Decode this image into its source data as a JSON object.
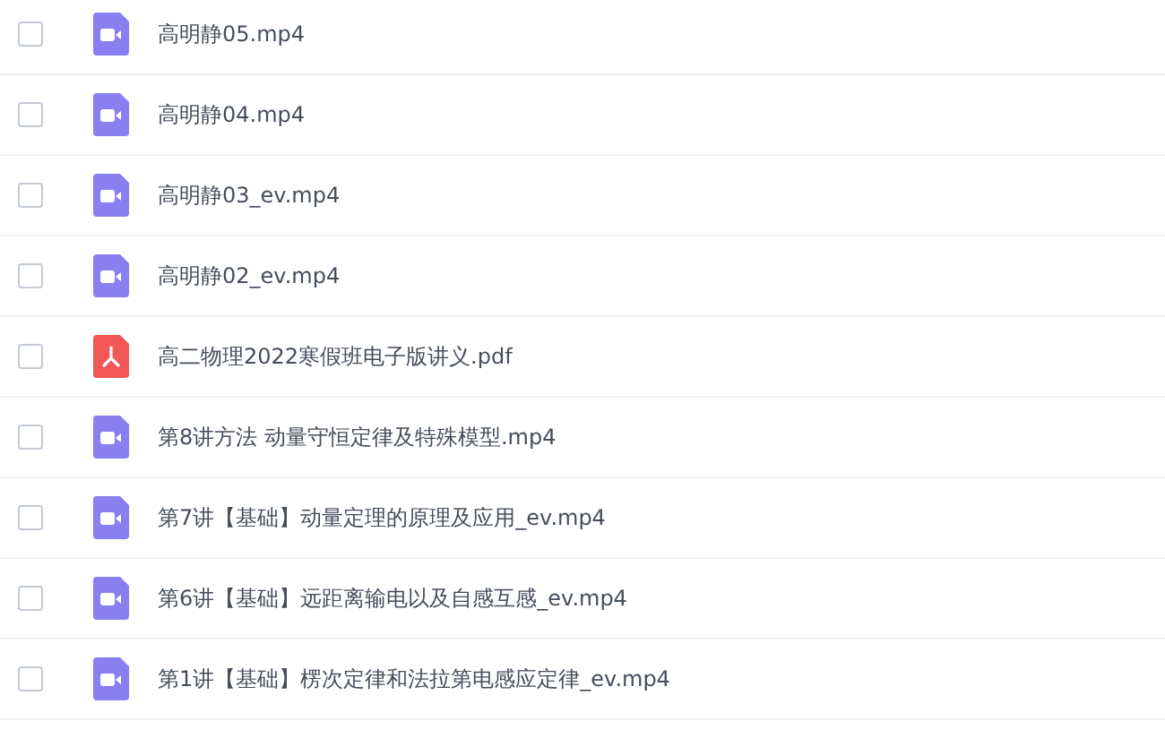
{
  "files": [
    {
      "name": "高明静05.mp4",
      "kind": "video",
      "checked": false
    },
    {
      "name": "高明静04.mp4",
      "kind": "video",
      "checked": false
    },
    {
      "name": "高明静03_ev.mp4",
      "kind": "video",
      "checked": false
    },
    {
      "name": "高明静02_ev.mp4",
      "kind": "video",
      "checked": false
    },
    {
      "name": "高二物理2022寒假班电子版讲义.pdf",
      "kind": "pdf",
      "checked": false
    },
    {
      "name": "第8讲方法 动量守恒定律及特殊模型.mp4",
      "kind": "video",
      "checked": false
    },
    {
      "name": "第7讲【基础】动量定理的原理及应用_ev.mp4",
      "kind": "video",
      "checked": false
    },
    {
      "name": "第6讲【基础】远距离输电以及自感互感_ev.mp4",
      "kind": "video",
      "checked": false
    },
    {
      "name": "第1讲【基础】楞次定律和法拉第电感应定律_ev.mp4",
      "kind": "video",
      "checked": false
    }
  ]
}
